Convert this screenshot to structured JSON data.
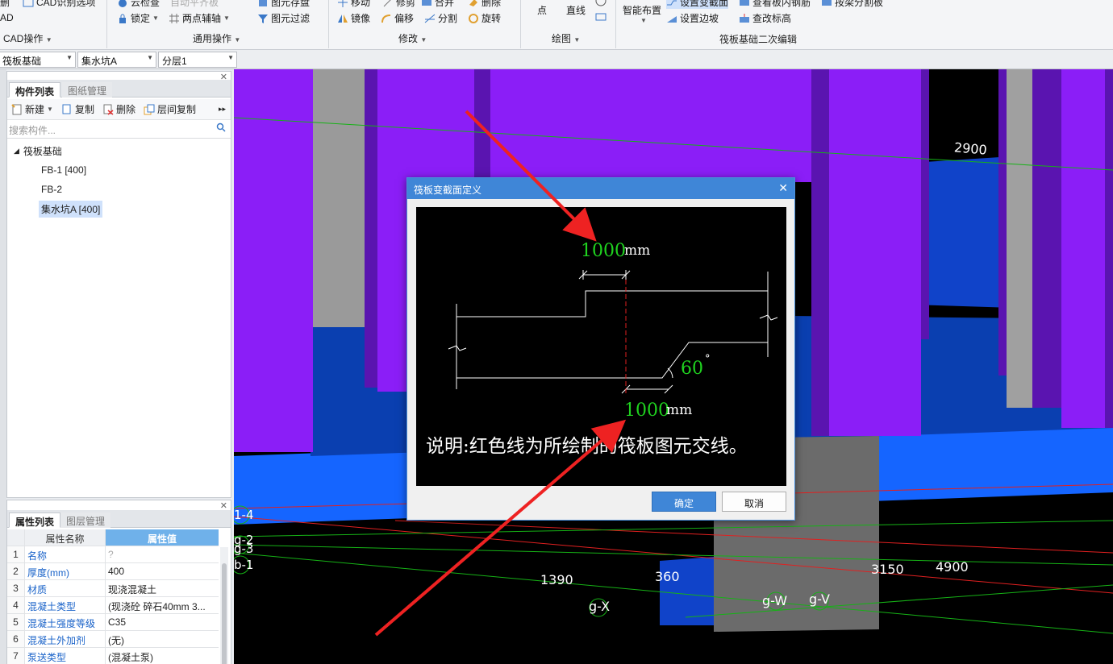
{
  "ribbon": {
    "groups": [
      {
        "title": "CAD操作",
        "items": [
          "CAD识别选项",
          "锁定",
          "两点辅轴"
        ]
      },
      {
        "title": "通用操作",
        "items": [
          "云检查",
          "自动平齐板",
          "图元存盘",
          "图元过滤"
        ]
      },
      {
        "title": "修改",
        "items": [
          "移动",
          "修剪",
          "合并",
          "删除",
          "镜像",
          "偏移",
          "分割",
          "旋转"
        ]
      },
      {
        "title": "绘图",
        "items": [
          "点",
          "直线"
        ]
      },
      {
        "title": "筏板基础二次编辑",
        "items": [
          "智能布置",
          "设置变截面",
          "设置边坡",
          "查看板内钢筋",
          "查改标高",
          "按梁分割板"
        ]
      }
    ],
    "left_cut_labels": [
      "删",
      "AD"
    ]
  },
  "selectors": {
    "type": "筏板基础",
    "component": "集水坑A",
    "layer": "分层1"
  },
  "component_panel": {
    "tabs": [
      "构件列表",
      "图纸管理"
    ],
    "toolbar": [
      "新建",
      "复制",
      "删除",
      "层间复制"
    ],
    "search_placeholder": "搜索构件...",
    "tree": {
      "root": "筏板基础",
      "children": [
        "FB-1 [400]",
        "FB-2",
        "集水坑A [400]"
      ]
    }
  },
  "property_panel": {
    "tabs": [
      "属性列表",
      "图层管理"
    ],
    "headers": [
      "属性名称",
      "属性值"
    ],
    "rows": [
      {
        "n": "1",
        "name": "名称",
        "value": "?"
      },
      {
        "n": "2",
        "name": "厚度(mm)",
        "value": "400"
      },
      {
        "n": "3",
        "name": "材质",
        "value": "现浇混凝土"
      },
      {
        "n": "4",
        "name": "混凝土类型",
        "value": "(现浇砼 碎石40mm 3..."
      },
      {
        "n": "5",
        "name": "混凝土强度等级",
        "value": "C35"
      },
      {
        "n": "6",
        "name": "混凝土外加剂",
        "value": "(无)"
      },
      {
        "n": "7",
        "name": "泵送类型",
        "value": "(混凝土泵)"
      }
    ]
  },
  "viewport": {
    "dimensions": [
      "2900",
      "1390",
      "360",
      "3150",
      "4900"
    ],
    "axis_labels": [
      "g-X",
      "g-W",
      "g-V",
      "1-4",
      "b-1",
      "g-2",
      "g-3"
    ]
  },
  "dialog": {
    "title": "筏板变截面定义",
    "top_value": "1000",
    "bottom_value": "1000",
    "unit": "mm",
    "angle": "60",
    "degree_mark": "°",
    "note": "说明:红色线为所绘制的筏板图元交线。",
    "ok": "确定",
    "cancel": "取消"
  },
  "colors": {
    "accent": "#3f86d7",
    "purple": "#8b1ef7",
    "dark_purple": "#5a14b0",
    "blue": "#1565ff",
    "green_text": "#1fd21f"
  }
}
